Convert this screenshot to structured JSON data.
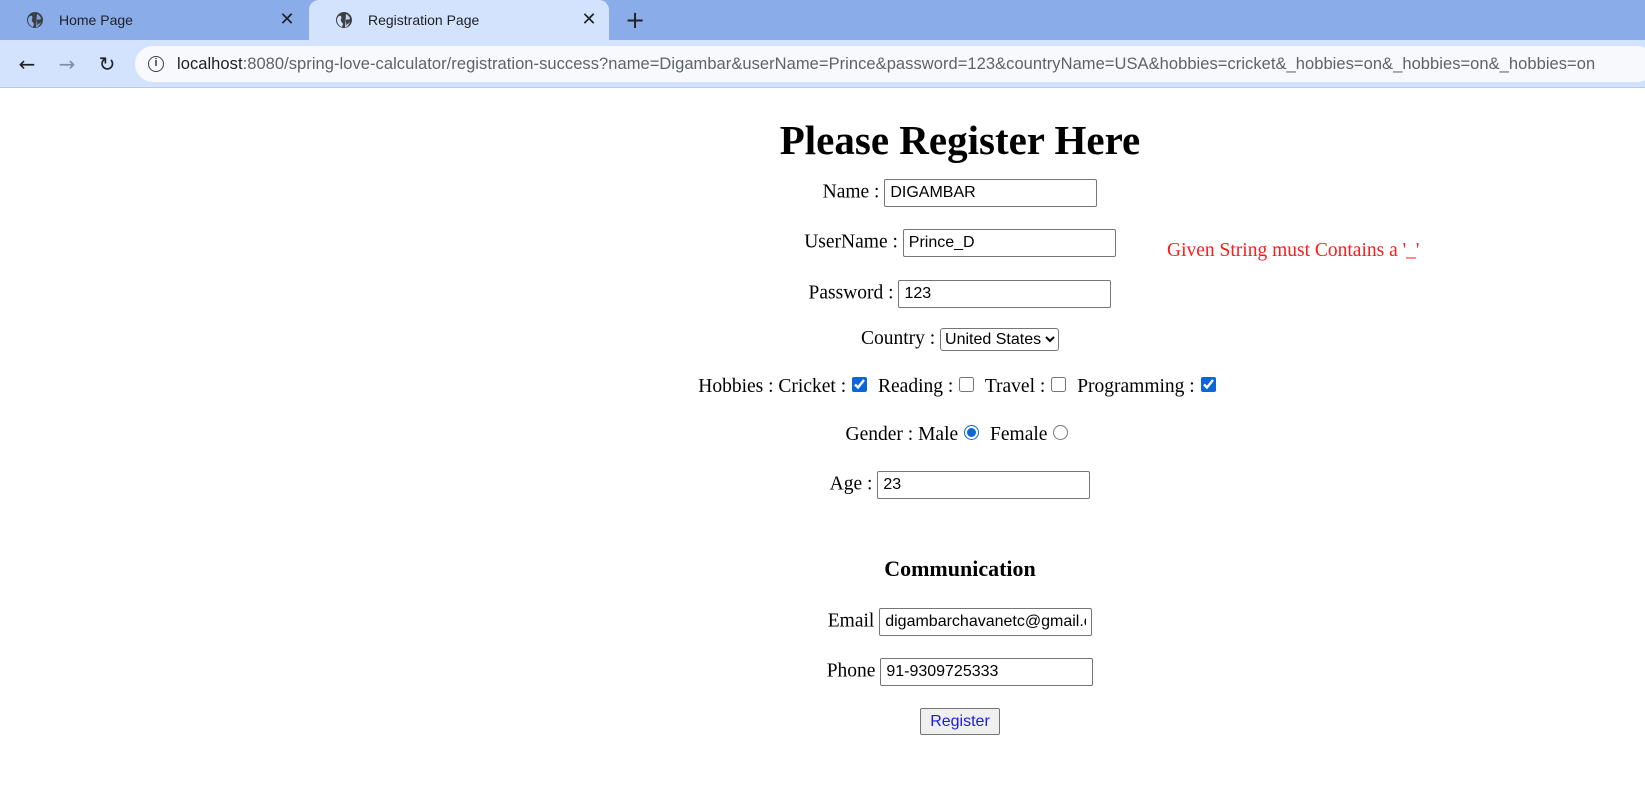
{
  "browser": {
    "tabs": [
      {
        "label": "Home Page",
        "active": false
      },
      {
        "label": "Registration Page",
        "active": true
      }
    ],
    "url_host": "localhost",
    "url_rest": ":8080/spring-love-calculator/registration-success?name=Digambar&userName=Prince&password=123&countryName=USA&hobbies=cricket&_hobbies=on&_hobbies=on&_hobbies=on"
  },
  "page": {
    "title": "Please Register Here",
    "name_label": "Name :",
    "name_value": "DIGAMBAR",
    "username_label": "UserName :",
    "username_value": "Prince_D",
    "username_error": "Given String must Contains a '_'",
    "password_label": "Password :",
    "password_value": "123",
    "country_label": "Country :",
    "country_selected": "United States",
    "hobbies_label": "Hobbies :",
    "hobbies": [
      {
        "label": "Cricket :",
        "checked": true
      },
      {
        "label": "Reading :",
        "checked": false
      },
      {
        "label": "Travel :",
        "checked": false
      },
      {
        "label": "Programming :",
        "checked": true
      }
    ],
    "gender_label": "Gender :",
    "gender_options": [
      {
        "label": "Male",
        "checked": true
      },
      {
        "label": "Female",
        "checked": false
      }
    ],
    "age_label": "Age :",
    "age_value": "23",
    "communication_heading": "Communication",
    "email_label": "Email",
    "email_value": "digambarchavanetc@gmail.com",
    "phone_label": "Phone",
    "phone_value": "91-9309725333",
    "register_label": "Register"
  },
  "colors": {
    "tabstrip": "#8aadea",
    "toolbar": "#d3e3fd",
    "error": "#ff1a1a",
    "register_text": "#1a1adf"
  }
}
